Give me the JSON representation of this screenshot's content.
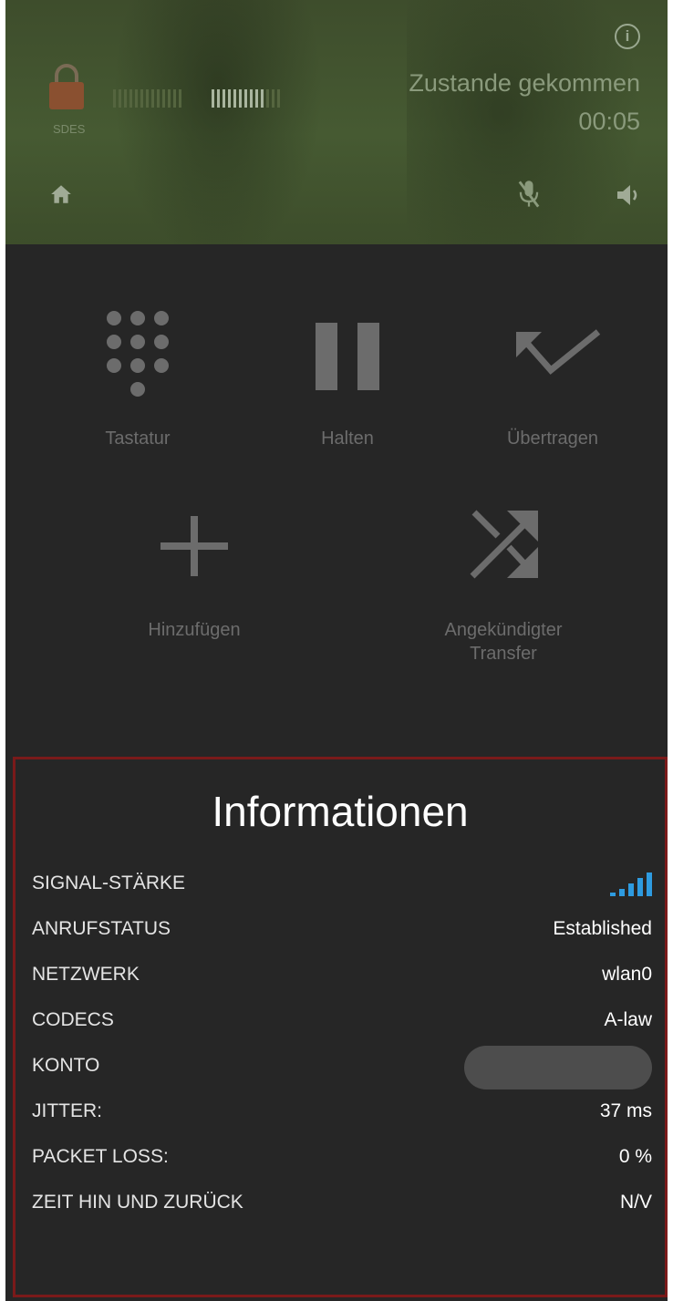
{
  "header": {
    "encryption_label": "SDES",
    "call_state": "Zustande gekommen",
    "call_timer": "00:05",
    "info_icon": "info-icon",
    "home_icon": "home-icon",
    "mute_icon": "mic-off-icon",
    "speaker_icon": "speaker-icon"
  },
  "actions": {
    "keypad": {
      "label": "Tastatur",
      "icon": "dialpad-icon"
    },
    "hold": {
      "label": "Halten",
      "icon": "pause-icon"
    },
    "transfer": {
      "label": "Übertragen",
      "icon": "transfer-icon"
    },
    "add": {
      "label": "Hinzufügen",
      "icon": "plus-icon"
    },
    "attended_transfer": {
      "label": "Angekündigter Transfer",
      "label_line1": "Angekündigter",
      "label_line2": "Transfer",
      "icon": "shuffle-icon"
    }
  },
  "info": {
    "title": "Informationen",
    "rows": [
      {
        "key": "SIGNAL-STÄRKE",
        "value": ""
      },
      {
        "key": "ANRUFSTATUS",
        "value": "Established"
      },
      {
        "key": "NETZWERK",
        "value": "wlan0"
      },
      {
        "key": "CODECS",
        "value": "A-law"
      },
      {
        "key": "KONTO",
        "value": ""
      },
      {
        "key": "JITTER:",
        "value": "37 ms"
      },
      {
        "key": "PACKET LOSS:",
        "value": "0 %"
      },
      {
        "key": "ZEIT HIN UND ZURÜCK",
        "value": "N/V"
      }
    ],
    "signal_level": 5,
    "signal_max": 5,
    "signal_color": "#2e9be0"
  },
  "colors": {
    "header_bg": "#465a32",
    "body_bg": "#262626",
    "panel_border": "#7a1a1a"
  }
}
